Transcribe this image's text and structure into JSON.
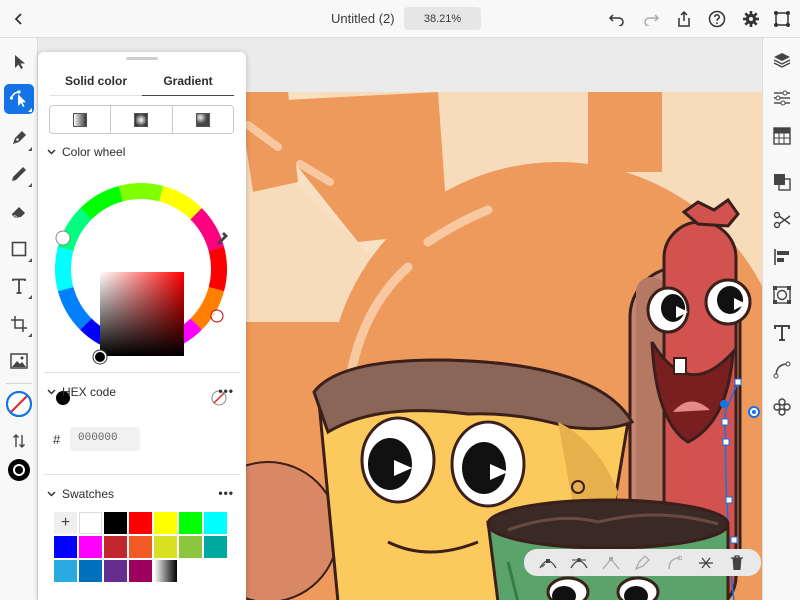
{
  "header": {
    "title": "Untitled (2)",
    "zoom": "38.21%",
    "icons": [
      "back-chevron-icon",
      "undo-icon",
      "redo-icon",
      "share-icon",
      "help-icon",
      "settings-gear-icon",
      "arrange-icon"
    ]
  },
  "left_toolbar": {
    "tools": [
      "selection-tool-icon",
      "direct-selection-tool-icon",
      "pen-tool-icon",
      "pencil-tool-icon",
      "eraser-tool-icon",
      "rectangle-tool-icon",
      "type-tool-icon",
      "transform-tool-icon",
      "image-tool-icon",
      "fill-stroke-swatch-icon",
      "swap-icon",
      "stroke-swatch-icon"
    ],
    "active_tool": "direct-selection-tool-icon"
  },
  "right_toolbar": {
    "tools": [
      "layers-icon",
      "properties-icon",
      "libraries-icon",
      "pathfinder-icon",
      "scissors-icon",
      "align-icon",
      "image-trace-icon",
      "type-panel-icon",
      "path-icon",
      "repeat-icon"
    ]
  },
  "color_panel": {
    "tabs": [
      {
        "label": "Solid color",
        "selected": false
      },
      {
        "label": "Gradient",
        "selected": true
      }
    ],
    "gradient_types": [
      "linear-gradient-icon",
      "radial-gradient-icon",
      "freeform-gradient-icon"
    ],
    "color_wheel": {
      "heading": "Color wheel",
      "current_fill": "#000000"
    },
    "hex": {
      "heading": "HEX code",
      "prefix": "#",
      "value": "000000"
    },
    "swatches": {
      "heading": "Swatches",
      "colors": [
        "#ffffff",
        "#000000",
        "#ff0000",
        "#ffff00",
        "#00ff00",
        "#00ffff",
        "#0000ff",
        "#ff00ff",
        "#c1272d",
        "#f15a24",
        "#d9e021",
        "#8cc63f",
        "#00a99d",
        "#29abe2",
        "#0071bc",
        "#662d91",
        "#9e005d",
        "gradient-white-black"
      ]
    }
  },
  "path_toolbar": {
    "icons": [
      "convert-anchor-icon",
      "smooth-anchor-icon",
      "corner-anchor-icon",
      "add-anchor-icon",
      "remove-anchor-icon",
      "cut-path-icon",
      "delete-icon"
    ]
  },
  "colors": {
    "accent": "#1473e6",
    "canvas_background": "#f7dcbc",
    "sun": "#ef9a5d"
  }
}
